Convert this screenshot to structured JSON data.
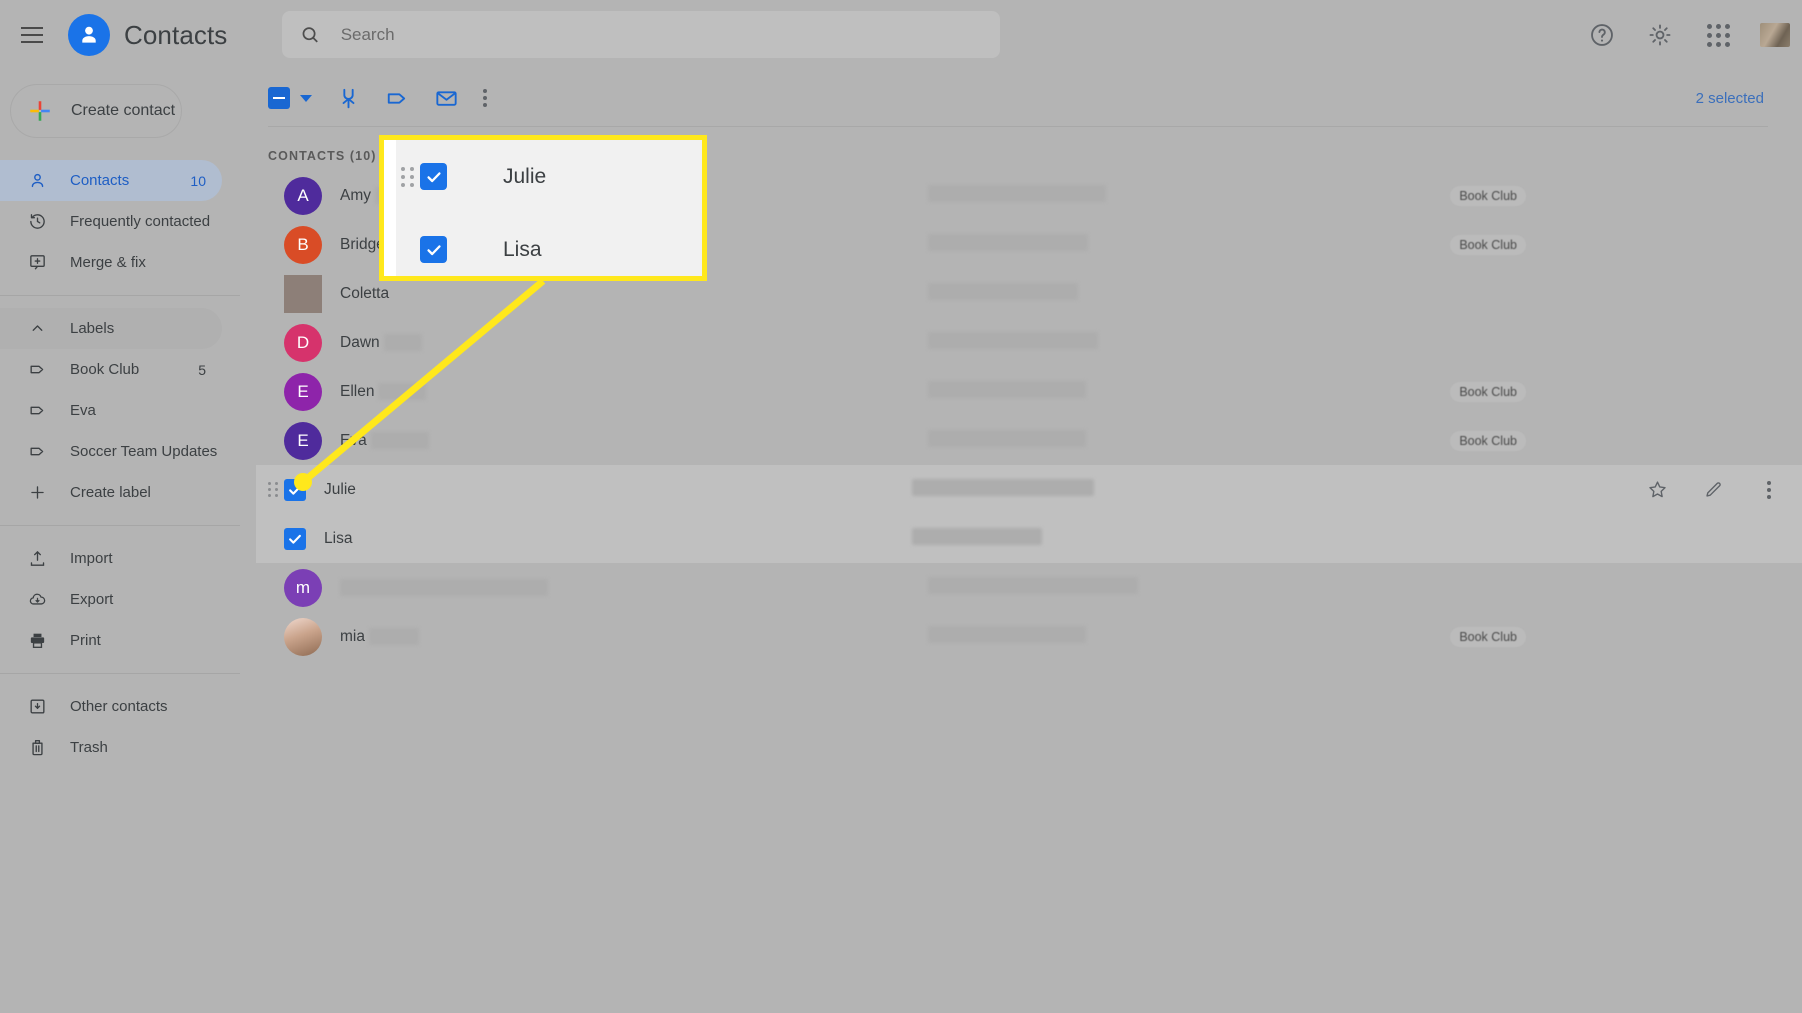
{
  "app": {
    "title": "Contacts",
    "menu_icon": "hamburger-icon",
    "logo_icon": "contacts-person-icon"
  },
  "search": {
    "placeholder": "Search",
    "value": "",
    "icon": "search-icon"
  },
  "topbar_right": {
    "help_icon": "help-circle-icon",
    "settings_icon": "gear-icon",
    "apps_icon": "apps-grid-icon",
    "avatar_icon": "user-avatar-photo"
  },
  "sidebar": {
    "create_contact": {
      "label": "Create contact",
      "icon": "plus-multicolor-icon"
    },
    "items": [
      {
        "label": "Contacts",
        "icon": "person-icon",
        "count": "10",
        "active": true
      },
      {
        "label": "Frequently contacted",
        "icon": "clock-history-icon",
        "count": ""
      },
      {
        "label": "Merge & fix",
        "icon": "merge-fix-icon",
        "count": ""
      }
    ],
    "labels_header": {
      "label": "Labels",
      "icon": "chevron-up-icon"
    },
    "labels": [
      {
        "label": "Book Club",
        "icon": "tag-icon",
        "count": "5"
      },
      {
        "label": "Eva",
        "icon": "tag-icon",
        "count": ""
      },
      {
        "label": "Soccer Team Updates",
        "icon": "tag-icon",
        "count": ""
      },
      {
        "label": "Create label",
        "icon": "plus-icon",
        "count": ""
      }
    ],
    "tools": [
      {
        "label": "Import",
        "icon": "import-upload-icon"
      },
      {
        "label": "Export",
        "icon": "export-cloud-down-icon"
      },
      {
        "label": "Print",
        "icon": "printer-icon"
      }
    ],
    "footer": [
      {
        "label": "Other contacts",
        "icon": "other-contacts-icon"
      },
      {
        "label": "Trash",
        "icon": "trash-icon"
      }
    ]
  },
  "toolbar": {
    "select_all_icon": "indeterminate-checkbox-icon",
    "dropdown_icon": "caret-down-icon",
    "merge_icon": "merge-icon",
    "label_icon": "tag-icon",
    "email_icon": "envelope-icon",
    "more_icon": "more-vertical-icon",
    "selected_text": "2 selected"
  },
  "list": {
    "section_title": "CONTACTS (10)",
    "rows": [
      {
        "name": "Amy",
        "initial": "A",
        "avatar_color": "#4f2b9c",
        "avatar_kind": "letter",
        "name_blur_w": 46,
        "email_blur_w": 0,
        "phone_blur_w": 178,
        "label": "Book Club",
        "selected": false,
        "hovered": false
      },
      {
        "name": "Bridget",
        "initial": "B",
        "avatar_color": "#d94c26",
        "avatar_kind": "letter",
        "name_blur_w": 0,
        "email_blur_w": 0,
        "phone_blur_w": 160,
        "label": "Book Club",
        "selected": false,
        "hovered": false
      },
      {
        "name": "Coletta",
        "initial": "",
        "avatar_color": "#8d7f78",
        "avatar_kind": "square",
        "name_blur_w": 0,
        "email_blur_w": 0,
        "phone_blur_w": 150,
        "label": "",
        "selected": false,
        "hovered": false
      },
      {
        "name": "Dawn",
        "initial": "D",
        "avatar_color": "#d6336c",
        "avatar_kind": "letter",
        "name_blur_w": 38,
        "email_blur_w": 0,
        "phone_blur_w": 170,
        "label": "",
        "selected": false,
        "hovered": false
      },
      {
        "name": "Ellen",
        "initial": "E",
        "avatar_color": "#8e24aa",
        "avatar_kind": "letter",
        "name_blur_w": 48,
        "email_blur_w": 0,
        "phone_blur_w": 158,
        "label": "Book Club",
        "selected": false,
        "hovered": false
      },
      {
        "name": "Eva",
        "initial": "E",
        "avatar_color": "#4f2b9c",
        "avatar_kind": "letter",
        "name_blur_w": 58,
        "email_blur_w": 0,
        "phone_blur_w": 158,
        "label": "Book Club",
        "selected": false,
        "hovered": false
      },
      {
        "name": "Julie",
        "initial": "",
        "avatar_color": "",
        "avatar_kind": "check",
        "name_blur_w": 0,
        "email_blur_w": 0,
        "phone_blur_w": 182,
        "label": "",
        "selected": true,
        "hovered": true
      },
      {
        "name": "Lisa",
        "initial": "",
        "avatar_color": "",
        "avatar_kind": "check",
        "name_blur_w": 0,
        "email_blur_w": 0,
        "phone_blur_w": 130,
        "label": "",
        "selected": true,
        "hovered": false
      },
      {
        "name": "",
        "initial": "m",
        "avatar_color": "#7b3fb5",
        "avatar_kind": "letter",
        "name_blur_w": 208,
        "email_blur_w": 0,
        "phone_blur_w": 210,
        "label": "",
        "selected": false,
        "hovered": false
      },
      {
        "name": "mia",
        "initial": "",
        "avatar_color": "#e8c3b8",
        "avatar_kind": "photo",
        "name_blur_w": 50,
        "email_blur_w": 0,
        "phone_blur_w": 158,
        "label": "Book Club",
        "selected": false,
        "hovered": false
      }
    ],
    "row_actions": {
      "star_icon": "star-outline-icon",
      "edit_icon": "pencil-edit-icon",
      "more_icon": "more-vertical-icon"
    }
  },
  "callout": {
    "border_color": "#ffe81c",
    "rows": [
      {
        "name": "Julie",
        "checked": true,
        "has_drag_handle": true
      },
      {
        "name": "Lisa",
        "checked": true,
        "has_drag_handle": false
      }
    ],
    "pointer": {
      "color": "#ffe81c"
    }
  },
  "colors": {
    "accent_blue": "#1a73e8",
    "highlight_yellow": "#ffe81c",
    "page_bg": "#b4b4b4"
  }
}
